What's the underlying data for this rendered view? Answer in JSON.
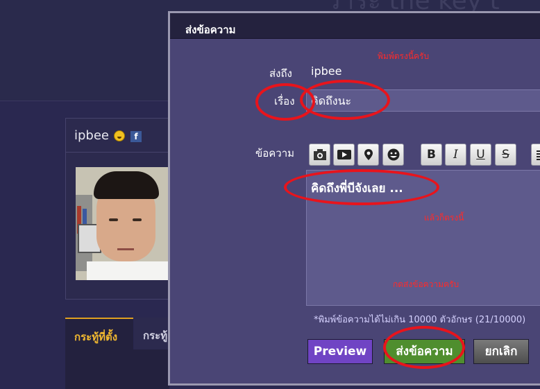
{
  "background": {
    "title_fragment": "วาระ the key t",
    "profile": {
      "name": "ipbee"
    },
    "tabs": [
      "กระทู้ที่ตั้ง",
      "กระทู้"
    ]
  },
  "modal": {
    "title": "ส่งข้อความ",
    "to_label": "ส่งถึง",
    "to_value": "ipbee",
    "subject_label": "เรื่อง",
    "subject_value": "คิดถึงนะ",
    "message_label": "ข้อความ",
    "message_value": "คิดถึงพี่บีจังเลย ...",
    "char_limit_note": "*พิมพ์ข้อความได้ไม่เกิน 10000 ตัวอักษร (21/10000)",
    "toolbar": [
      {
        "name": "photo-icon"
      },
      {
        "name": "video-icon"
      },
      {
        "name": "location-icon"
      },
      {
        "name": "emoticon-icon"
      },
      {
        "name": "bold-button",
        "label": "B"
      },
      {
        "name": "italic-button",
        "label": "I"
      },
      {
        "name": "underline-button",
        "label": "U"
      },
      {
        "name": "strikethrough-button",
        "label": "S"
      },
      {
        "name": "align-icon"
      }
    ],
    "buttons": {
      "preview": "Preview",
      "send": "ส่งข้อความ",
      "cancel": "ยกเลิก"
    }
  },
  "annotations": {
    "type_here": "พิมพ์ตรงนี้ครับ",
    "then_here": "แล้วก็ตรงนี้",
    "press_send": "กดส่งข้อความครับ",
    "color": "#e8141c"
  }
}
